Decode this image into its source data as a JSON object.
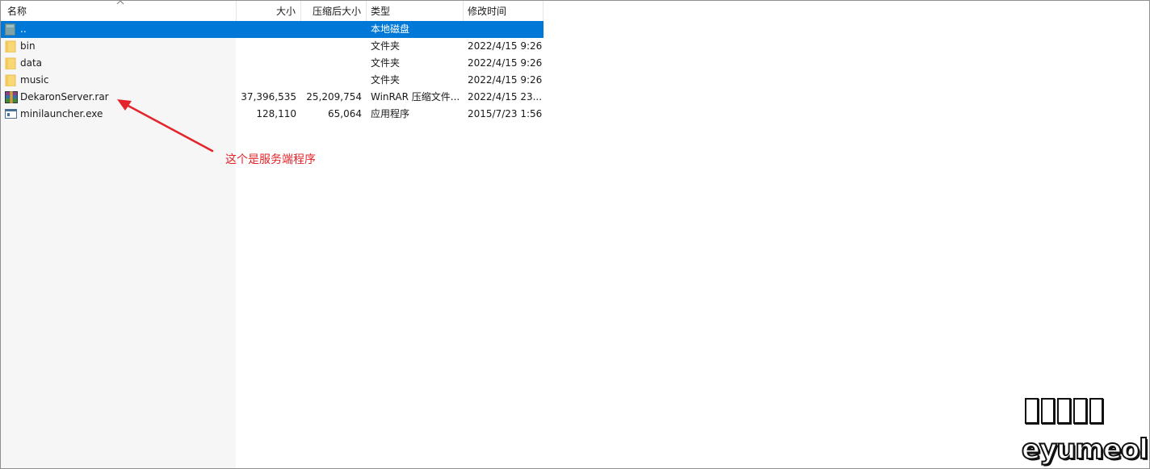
{
  "columns": {
    "name": "名称",
    "size": "大小",
    "packed": "压缩后大小",
    "type": "类型",
    "modified": "修改时间"
  },
  "rows": [
    {
      "icon": "parent-folder-icon",
      "name": "..",
      "size": "",
      "packed": "",
      "type": "本地磁盘",
      "modified": "",
      "selected": true
    },
    {
      "icon": "folder-icon",
      "name": "bin",
      "size": "",
      "packed": "",
      "type": "文件夹",
      "modified": "2022/4/15 9:26"
    },
    {
      "icon": "folder-icon",
      "name": "data",
      "size": "",
      "packed": "",
      "type": "文件夹",
      "modified": "2022/4/15 9:26"
    },
    {
      "icon": "folder-icon",
      "name": "music",
      "size": "",
      "packed": "",
      "type": "文件夹",
      "modified": "2022/4/15 9:26"
    },
    {
      "icon": "rar-archive-icon",
      "name": "DekaronServer.rar",
      "size": "37,396,535",
      "packed": "25,209,754",
      "type": "WinRAR 压缩文件...",
      "modified": "2022/4/15 23..."
    },
    {
      "icon": "exe-application-icon",
      "name": "minilauncher.exe",
      "size": "128,110",
      "packed": "65,064",
      "type": "应用程序",
      "modified": "2015/7/23 1:56"
    }
  ],
  "annotation": {
    "text": "这个是服务端程序",
    "color": "#e4242b"
  },
  "watermark": {
    "domain": "eyumeol.cn"
  },
  "colors": {
    "selection": "#0078d7",
    "folder": "#f8d775"
  }
}
